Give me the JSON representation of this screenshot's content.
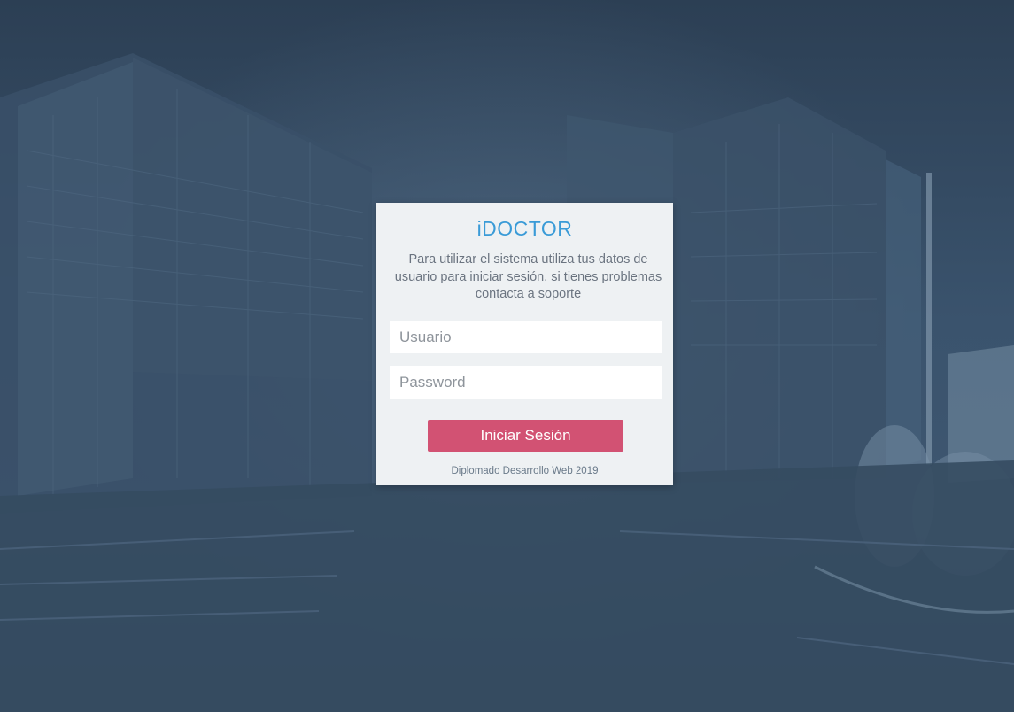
{
  "login": {
    "brand": "iDOCTOR",
    "intro": "Para utilizar el sistema utiliza tus datos de usuario para iniciar sesión, si tienes problemas contacta a soporte",
    "username": {
      "value": "",
      "placeholder": "Usuario"
    },
    "password": {
      "value": "",
      "placeholder": "Password"
    },
    "submit_label": "Iniciar Sesión",
    "footer": "Diplomado Desarrollo Web 2019"
  },
  "colors": {
    "background_tint": "#2e4258",
    "card": "#eef1f3",
    "brand": "#3a9bd7",
    "button": "#d25273"
  }
}
